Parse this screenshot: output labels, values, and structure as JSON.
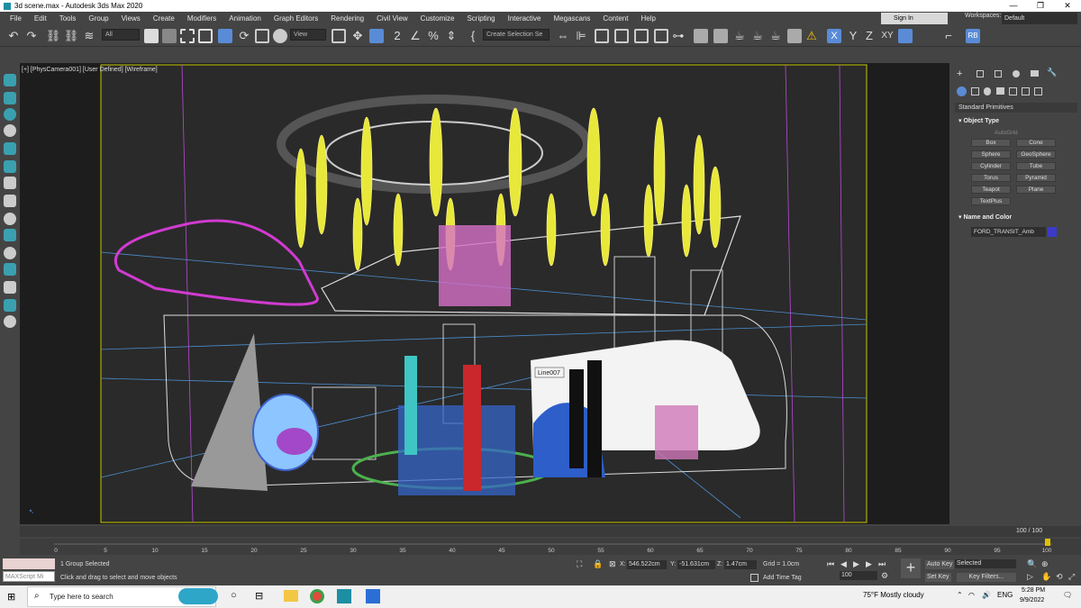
{
  "titlebar": {
    "title": "3d scene.max - Autodesk 3ds Max 2020",
    "minimize": "—",
    "maximize": "❐",
    "close": "✕"
  },
  "menu": [
    "File",
    "Edit",
    "Tools",
    "Group",
    "Views",
    "Create",
    "Modifiers",
    "Animation",
    "Graph Editors",
    "Rendering",
    "Civil View",
    "Customize",
    "Scripting",
    "Interactive",
    "Megascans",
    "Content",
    "Help"
  ],
  "account": {
    "signin": "Sign In",
    "workspaces_label": "Workspaces:",
    "workspace": "Default"
  },
  "toolbar": {
    "filter": "All",
    "ref_coord": "View",
    "selection_set": "Create Selection Se",
    "angle_snap_label": "2",
    "axis_x": "X",
    "axis_y": "Y",
    "axis_z": "Z",
    "axis_xy": "XY",
    "rb_label": "RB"
  },
  "viewport": {
    "label": "[+] [PhysCamera001] [User Defined] [Wireframe]",
    "tag_text": "Line007"
  },
  "command_panel": {
    "category": "Standard Primitives",
    "object_type_title": "Object Type",
    "autogrid": "AutoGrid",
    "buttons": [
      "Box",
      "Cone",
      "Sphere",
      "GeoSphere",
      "Cylinder",
      "Tube",
      "Torus",
      "Pyramid",
      "Teapot",
      "Plane",
      "TextPlus"
    ],
    "name_color_title": "Name and Color",
    "object_name": "FORD_TRANSIT_Amb",
    "object_color": "#3b3bc7"
  },
  "timeline": {
    "position": "100 / 100",
    "ticks": [
      "0",
      "5",
      "10",
      "15",
      "20",
      "25",
      "30",
      "35",
      "40",
      "45",
      "50",
      "55",
      "60",
      "65",
      "70",
      "75",
      "80",
      "85",
      "90",
      "95",
      "100"
    ]
  },
  "status": {
    "maxscript": "MAXScript Mi",
    "selection": "1 Group Selected",
    "prompt": "Click and drag to select and move objects",
    "x_label": "X:",
    "x_value": "546.522cm",
    "y_label": "Y:",
    "y_value": "-51.631cm",
    "z_label": "Z:",
    "z_value": "1.47cm",
    "grid": "Grid = 1.0cm",
    "add_time_tag": "Add Time Tag",
    "auto_key": "Auto Key",
    "set_key": "Set Key",
    "key_mode": "Selected",
    "key_filters": "Key Filters...",
    "frame": "100"
  },
  "taskbar": {
    "search_placeholder": "Type here to search",
    "weather": "75°F  Mostly cloudy",
    "lang": "ENG",
    "time": "5:28 PM",
    "date": "9/9/2022"
  }
}
